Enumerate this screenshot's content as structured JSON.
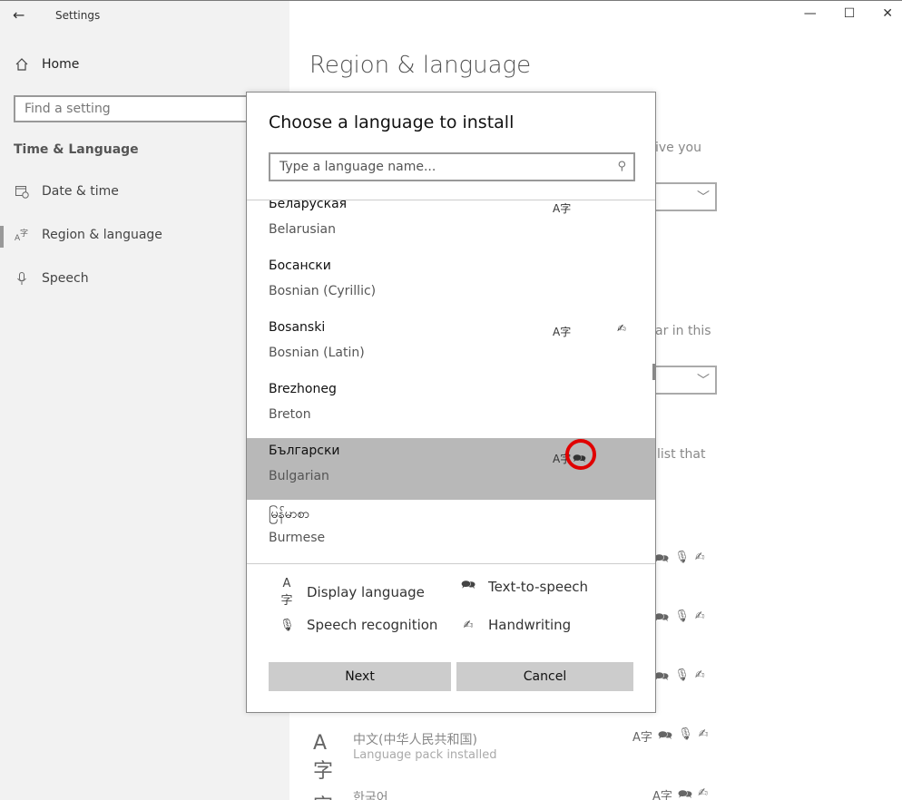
{
  "window": {
    "app_title": "Settings",
    "back_glyph": "←",
    "minimize_glyph": "—",
    "maximize_glyph": "☐",
    "close_glyph": "✕"
  },
  "sidebar": {
    "home_label": "Home",
    "search_placeholder": "Find a setting",
    "section_title": "Time & Language",
    "items": [
      {
        "label": "Date & time",
        "icon": "calendar-clock-icon"
      },
      {
        "label": "Region & language",
        "icon": "language-icon"
      },
      {
        "label": "Speech",
        "icon": "microphone-icon"
      }
    ]
  },
  "main": {
    "heading": "Region & language",
    "partial_texts": [
      "ive you",
      "ar in this",
      "list that"
    ],
    "languages": [
      {
        "name": "中文(中华人民共和国)",
        "status": "Language pack installed"
      },
      {
        "name": "한국어",
        "status": ""
      }
    ]
  },
  "dialog": {
    "title": "Choose a language to install",
    "search_placeholder": "Type a language name...",
    "list": [
      {
        "native": "Беларуская",
        "english": "Belarusian",
        "display": true,
        "tts": false,
        "handwriting": false
      },
      {
        "native": "Босански",
        "english": "Bosnian (Cyrillic)",
        "display": false,
        "tts": false,
        "handwriting": false
      },
      {
        "native": "Bosanski",
        "english": "Bosnian (Latin)",
        "display": true,
        "tts": false,
        "handwriting": true
      },
      {
        "native": "Brezhoneg",
        "english": "Breton",
        "display": false,
        "tts": false,
        "handwriting": false
      },
      {
        "native": "Български",
        "english": "Bulgarian",
        "display": true,
        "tts": true,
        "handwriting": false,
        "selected": true
      },
      {
        "native": "မြန်မာစာ",
        "english": "Burmese",
        "display": false,
        "tts": false,
        "handwriting": false
      }
    ],
    "legend": {
      "display_language": "Display language",
      "text_to_speech": "Text-to-speech",
      "speech_recognition": "Speech recognition",
      "handwriting": "Handwriting"
    },
    "next_label": "Next",
    "cancel_label": "Cancel"
  },
  "colors": {
    "selected_row": "#b8b8b8",
    "highlight_circle": "#e00000",
    "sidebar_bg": "#f2f2f2"
  }
}
